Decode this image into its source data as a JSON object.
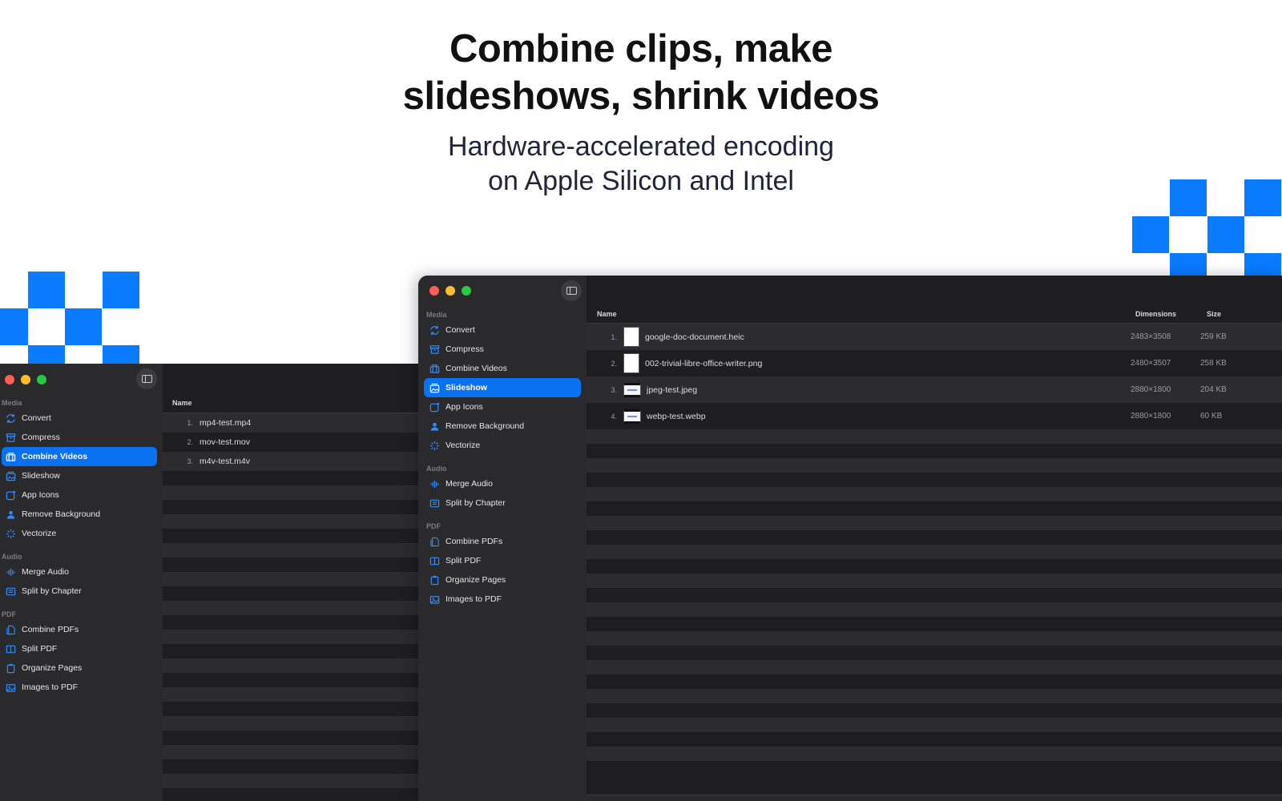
{
  "headline": {
    "title_line1": "Combine clips, make",
    "title_line2": "slideshows, shrink videos",
    "subtitle_line1": "Hardware-accelerated encoding",
    "subtitle_line2": "on Apple Silicon and Intel"
  },
  "colors": {
    "accent": "#0a7aff",
    "sidebar_bg": "#2a2a2d",
    "content_bg": "#1e1e20",
    "row_alt": "#2c2c30"
  },
  "sidebar_sections": {
    "media": "Media",
    "audio": "Audio",
    "pdf": "PDF"
  },
  "sidebar_items": {
    "convert": {
      "label": "Convert",
      "icon": "arrows-circle-icon"
    },
    "compress": {
      "label": "Compress",
      "icon": "archive-box-icon"
    },
    "combine_videos": {
      "label": "Combine Videos",
      "icon": "film-stack-icon"
    },
    "slideshow": {
      "label": "Slideshow",
      "icon": "photo-stack-icon"
    },
    "app_icons": {
      "label": "App Icons",
      "icon": "app-square-icon"
    },
    "remove_background": {
      "label": "Remove Background",
      "icon": "person-icon"
    },
    "vectorize": {
      "label": "Vectorize",
      "icon": "sparkle-icon"
    },
    "merge_audio": {
      "label": "Merge Audio",
      "icon": "waveform-icon"
    },
    "split_by_chapter": {
      "label": "Split by Chapter",
      "icon": "list-rectangle-icon"
    },
    "combine_pdfs": {
      "label": "Combine PDFs",
      "icon": "documents-icon"
    },
    "split_pdf": {
      "label": "Split PDF",
      "icon": "split-rectangle-icon"
    },
    "organize_pages": {
      "label": "Organize Pages",
      "icon": "clipboard-icon"
    },
    "images_to_pdf": {
      "label": "Images to PDF",
      "icon": "photo-icon"
    }
  },
  "left_window": {
    "active_item": "Combine Videos",
    "column_name": "Name",
    "files": [
      {
        "index": "1.",
        "name": "mp4-test.mp4"
      },
      {
        "index": "2.",
        "name": "mov-test.mov"
      },
      {
        "index": "3.",
        "name": "m4v-test.m4v"
      }
    ]
  },
  "right_window": {
    "active_item": "Slideshow",
    "columns": {
      "name": "Name",
      "dimensions": "Dimensions",
      "size": "Size"
    },
    "files": [
      {
        "index": "1.",
        "name": "google-doc-document.heic",
        "dimensions": "2483×3508",
        "size": "259 KB"
      },
      {
        "index": "2.",
        "name": "002-trivial-libre-office-writer.png",
        "dimensions": "2480×3507",
        "size": "258 KB"
      },
      {
        "index": "3.",
        "name": "jpeg-test.jpeg",
        "dimensions": "2880×1800",
        "size": "204 KB"
      },
      {
        "index": "4.",
        "name": "webp-test.webp",
        "dimensions": "2880×1800",
        "size": "60 KB"
      }
    ]
  }
}
